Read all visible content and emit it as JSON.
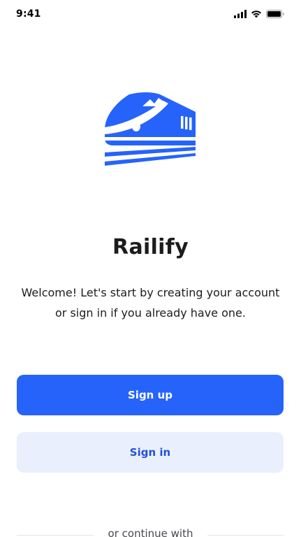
{
  "status_bar": {
    "time": "9:41",
    "icons": [
      "cellular-signal-icon",
      "wifi-icon",
      "battery-icon"
    ]
  },
  "logo": {
    "icon": "train-icon",
    "color": "#2563fb"
  },
  "app_name": "Railify",
  "welcome_line1": "Welcome! Let's start by creating your account",
  "welcome_line2": "or sign in if you already have one.",
  "buttons": {
    "sign_up": "Sign up",
    "sign_in": "Sign in"
  },
  "divider_text": "or continue with",
  "colors": {
    "primary": "#2563fb",
    "secondary_bg": "#e9effd",
    "secondary_text": "#2151d9",
    "text": "#1c1c1e"
  }
}
